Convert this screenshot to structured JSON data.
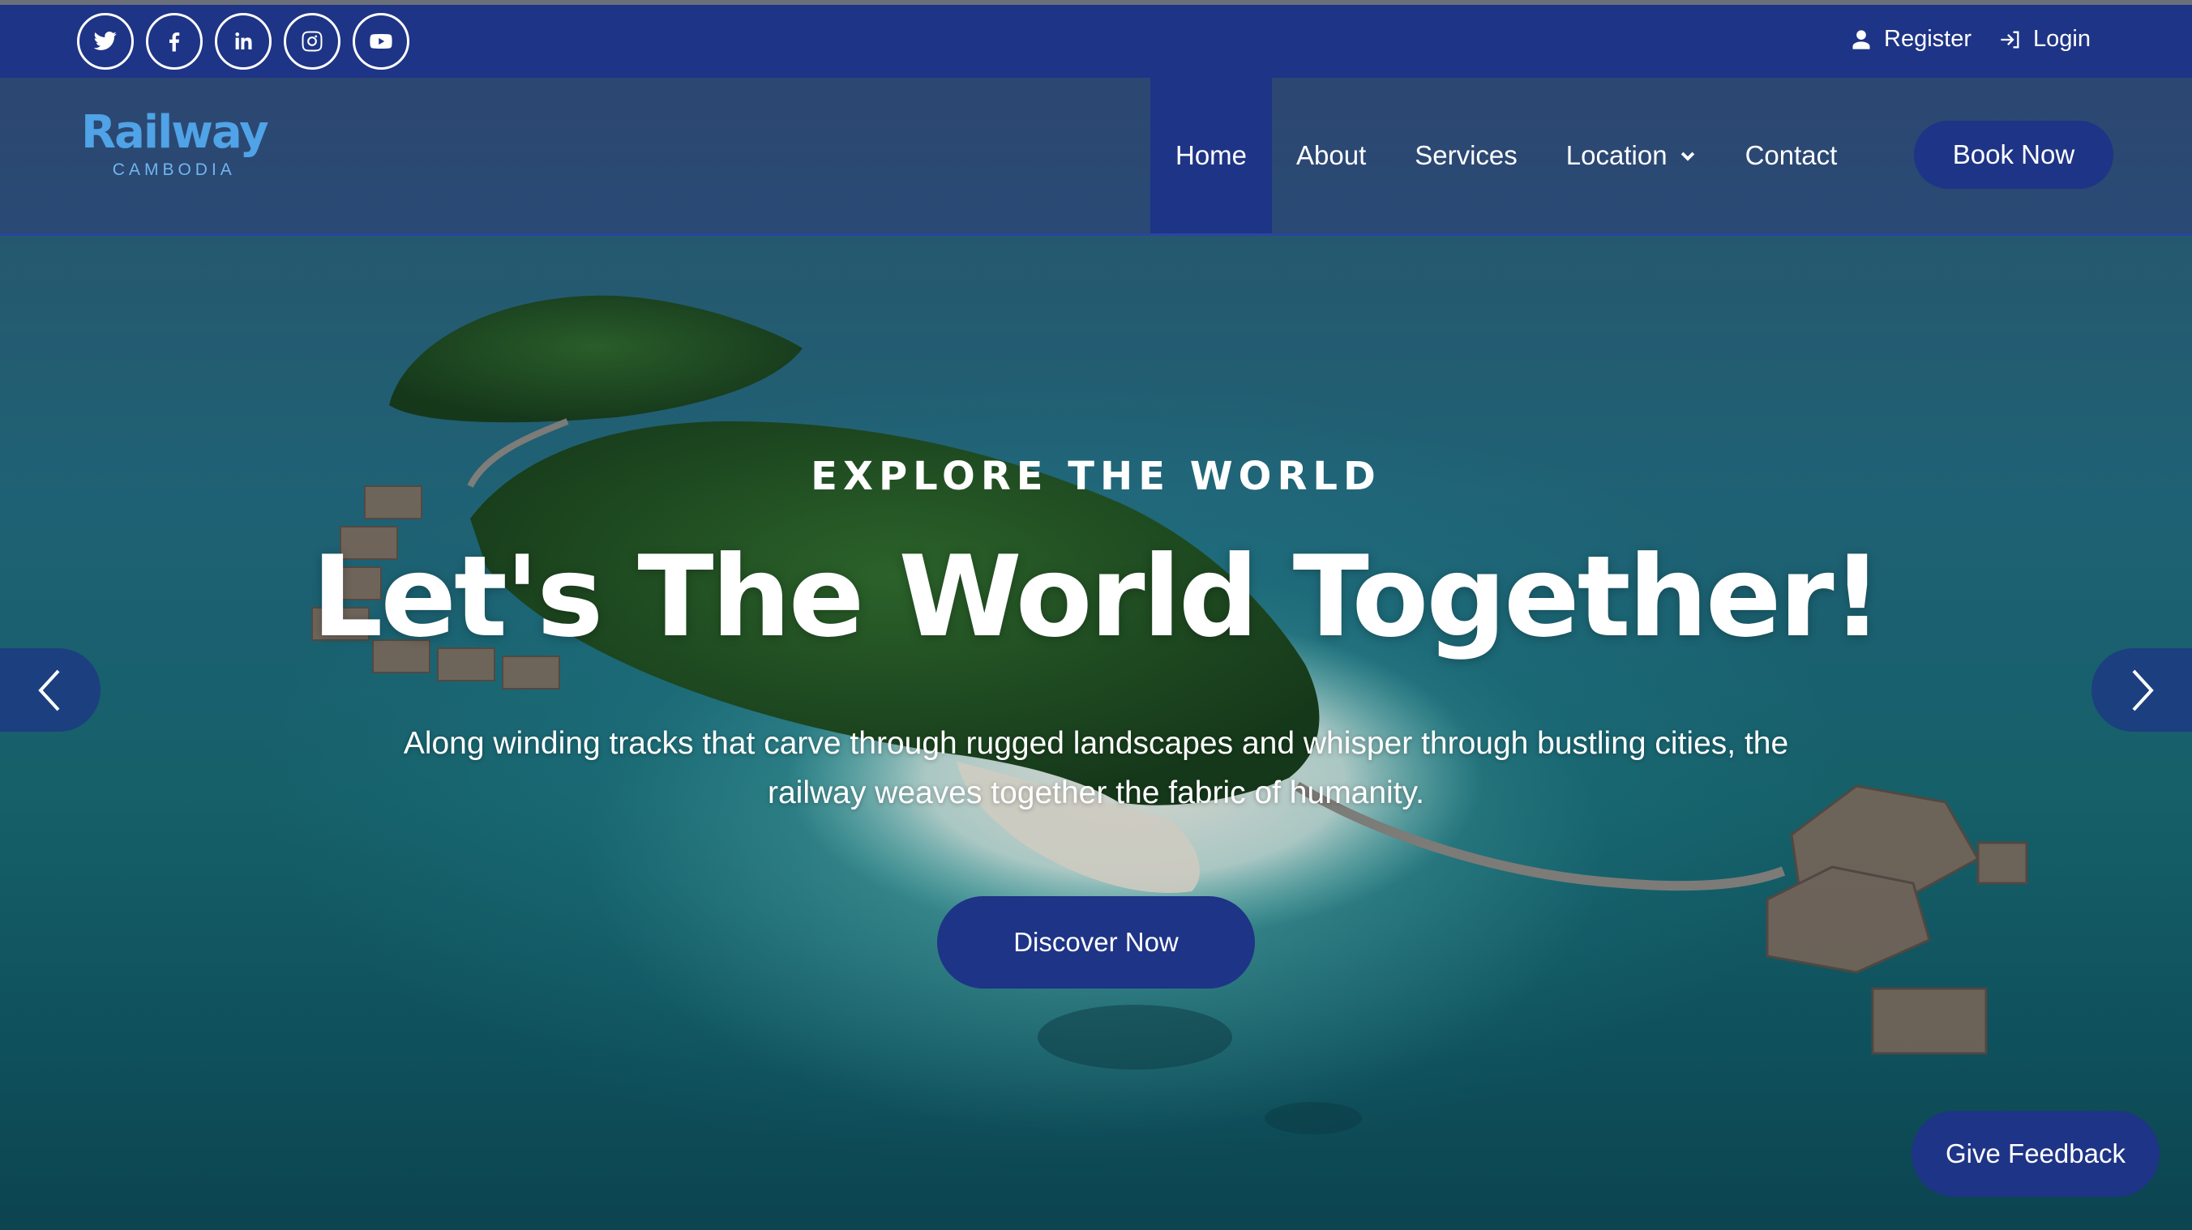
{
  "social": [
    {
      "name": "twitter-icon"
    },
    {
      "name": "facebook-icon"
    },
    {
      "name": "linkedin-icon"
    },
    {
      "name": "instagram-icon"
    },
    {
      "name": "youtube-icon"
    }
  ],
  "auth": {
    "register_label": "Register",
    "login_label": "Login"
  },
  "brand": {
    "name": "Railway",
    "tagline": "CAMBODIA"
  },
  "nav": {
    "items": [
      {
        "label": "Home",
        "active": true
      },
      {
        "label": "About"
      },
      {
        "label": "Services"
      },
      {
        "label": "Location",
        "has_dropdown": true
      },
      {
        "label": "Contact"
      }
    ],
    "book_label": "Book Now"
  },
  "hero": {
    "eyebrow": "EXPLORE THE WORLD",
    "headline": "Let's The World Together!",
    "subtext": "Along winding tracks that carve through rugged landscapes and whisper through bustling cities, the railway weaves together the fabric of humanity.",
    "cta_label": "Discover Now"
  },
  "feedback_label": "Give Feedback",
  "colors": {
    "primary": "#1e3486",
    "logo": "#4fa3e6",
    "text": "#ffffff"
  }
}
